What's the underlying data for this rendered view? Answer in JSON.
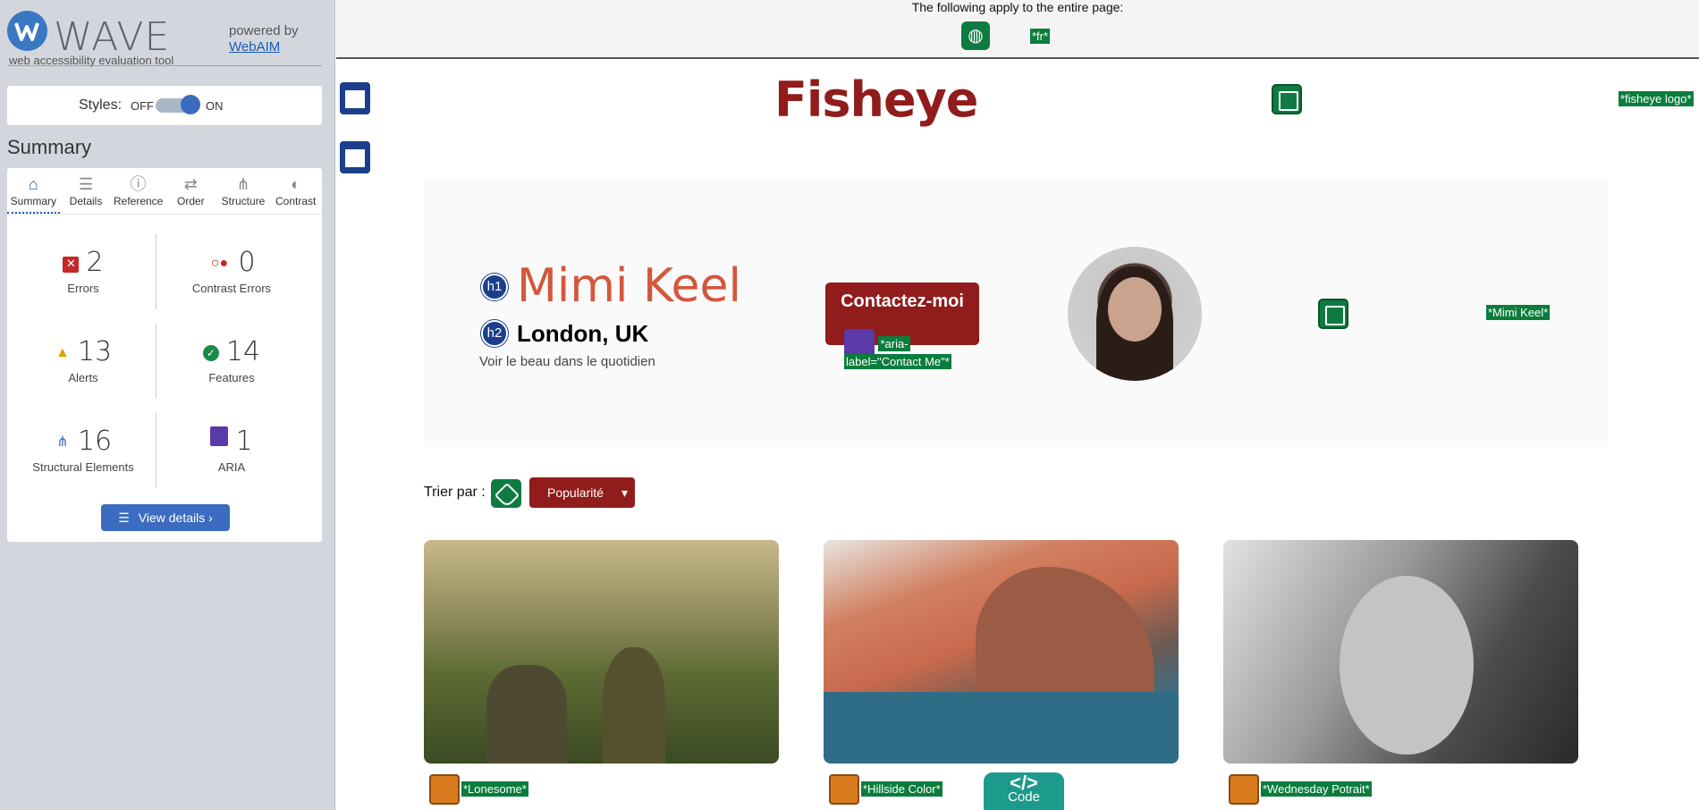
{
  "wave": {
    "brand": "WAVE",
    "subtitle": "web accessibility evaluation tool",
    "powered_by": "powered by",
    "webaim": "WebAIM",
    "styles_label": "Styles:",
    "styles_off": "OFF",
    "styles_on": "ON",
    "summary_title": "Summary",
    "tabs": [
      {
        "label": "Summary",
        "icon": "home-icon"
      },
      {
        "label": "Details",
        "icon": "list-icon"
      },
      {
        "label": "Reference",
        "icon": "info-icon"
      },
      {
        "label": "Order",
        "icon": "order-icon"
      },
      {
        "label": "Structure",
        "icon": "structure-icon"
      },
      {
        "label": "Contrast",
        "icon": "contrast-icon"
      }
    ],
    "stats": [
      {
        "value": "2",
        "label": "Errors",
        "color": "#c62828"
      },
      {
        "value": "0",
        "label": "Contrast Errors",
        "color": "#c62828"
      },
      {
        "value": "13",
        "label": "Alerts",
        "color": "#e0a100"
      },
      {
        "value": "14",
        "label": "Features",
        "color": "#1a8a4a"
      },
      {
        "value": "16",
        "label": "Structural Elements",
        "color": "#3b6cc0"
      },
      {
        "value": "1",
        "label": "ARIA",
        "color": "#5a3aa8"
      }
    ],
    "view_details": "View details ›"
  },
  "page": {
    "applies_text": "The following apply to the entire page:",
    "lang_tag": "*fr*",
    "logo_text": "Fisheye",
    "logo_tag": "*fisheye logo*",
    "h1_badge": "h1",
    "h2_badge": "h2",
    "name": "Mimi Keel",
    "city": "London, UK",
    "tagline": "Voir le beau dans le quotidien",
    "contact_label": "Contactez-moi",
    "aria_tag_1": "*aria-",
    "aria_tag_2": "label=\"Contact Me\"*",
    "portrait_tag": "*Mimi Keel*",
    "sort_label": "Trier par :",
    "sort_value": "Popularité",
    "captions": [
      "*Lonesome*",
      "*Hillside Color*",
      "*Wednesday Potrait*"
    ],
    "code_label": "Code",
    "code_icon": "</>"
  }
}
